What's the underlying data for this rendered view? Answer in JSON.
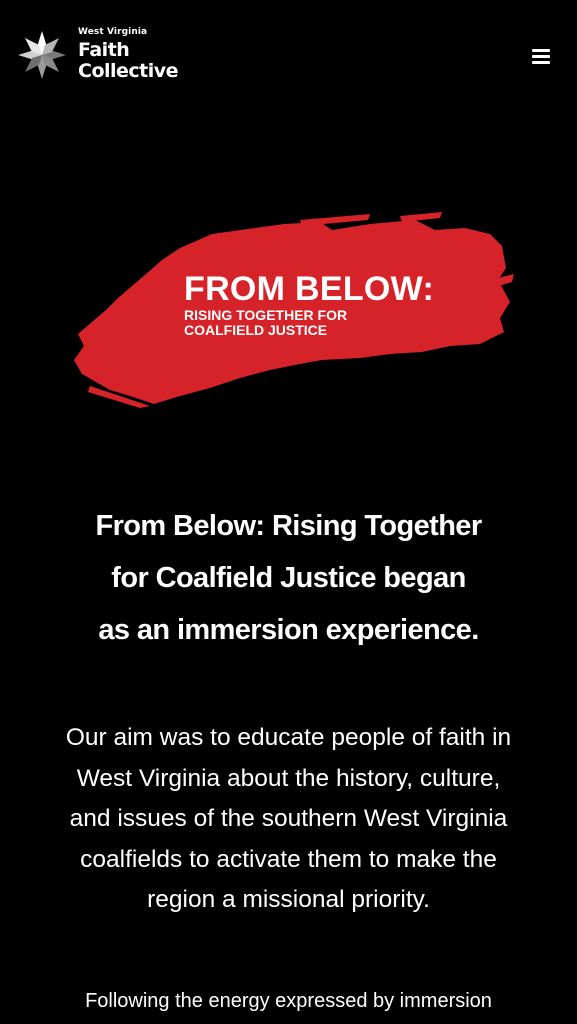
{
  "header": {
    "logo": {
      "kicker": "West Virginia",
      "line1": "Faith",
      "line2": "Collective",
      "icon": "star-quilt-icon"
    },
    "menu_icon": "hamburger-menu-icon"
  },
  "hero_banner": {
    "title": "FROM BELOW:",
    "subtitle_line1": "RISING TOGETHER FOR",
    "subtitle_line2": "COALFIELD JUSTICE",
    "brush_color": "#d62329"
  },
  "content": {
    "lead_line1": "From Below: Rising Together",
    "lead_line2": "for Coalfield Justice began",
    "lead_line3": "as an immersion experience.",
    "para1_line1": "Our aim was to educate people of faith in",
    "para1_line2": "West Virginia about the history, culture,",
    "para1_line3": "and issues of the southern West Virginia",
    "para1_line4": "coalfields to activate them to make the",
    "para1_line5": "region a missional priority.",
    "para2_line1": "Following the energy expressed by immersion"
  },
  "colors": {
    "background": "#000000",
    "text": "#ffffff",
    "accent": "#d62329"
  }
}
